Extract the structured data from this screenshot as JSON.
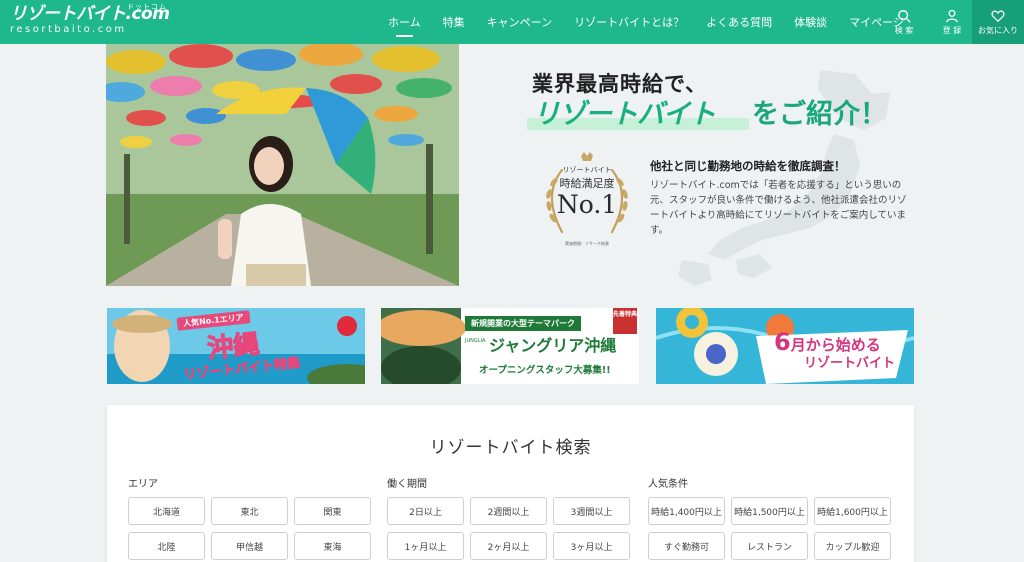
{
  "colors": {
    "brand_green": "#1fb88c",
    "fav_bg": "#169f78",
    "pink": "#d4357d"
  },
  "header": {
    "logo_text": "リゾートバイト.com",
    "logo_kana": "ドットコム",
    "logo_sub": "resortbaito.com",
    "nav": [
      "ホーム",
      "特集",
      "キャンペーン",
      "リゾートバイトとは？",
      "よくある質問",
      "体験談",
      "マイページ"
    ],
    "icons": {
      "search": "検 索",
      "login": "登 録",
      "favorite": "お気に入り"
    }
  },
  "hero": {
    "headline_1": "業界最高時給で、",
    "headline_2_highlight": "リゾートバイト",
    "headline_2_rest": "をご紹介！",
    "badge": {
      "line1": "リゾートバイト",
      "line2": "時給満足度",
      "rank": "No.1",
      "note": "実施期間：リサーチ結果"
    },
    "sub_heading": "他社と同じ勤務地の時給を徹底調査！",
    "sub_body": "リゾートバイト.comでは「若者を応援する」という思いの元、スタッフが良い条件で働けるよう、他社派遣会社のリゾートバイトより高時給にてリゾートバイトをご案内しています。"
  },
  "banners": {
    "okinawa": {
      "tag": "人気No.1エリア",
      "main": "沖縄",
      "sub": "リゾートバイト特集"
    },
    "junglia": {
      "top": "新規開業の大型テーマパーク",
      "logo": "JUNGLIA",
      "main": "ジャングリア沖縄",
      "bottom": "オープニングスタッフ大募集!!",
      "ribbon": "先着特典"
    },
    "june": {
      "month_num": "6",
      "month_rest": "月から始める",
      "sub": "リゾートバイト"
    }
  },
  "search": {
    "title": "リゾートバイト検索",
    "area": {
      "label": "エリア",
      "options": [
        "北海道",
        "東北",
        "関東",
        "北陸",
        "甲信越",
        "東海"
      ]
    },
    "period": {
      "label": "働く期間",
      "options": [
        "2日以上",
        "2週間以上",
        "3週間以上",
        "1ヶ月以上",
        "2ヶ月以上",
        "3ヶ月以上"
      ]
    },
    "conditions": {
      "label": "人気条件",
      "options": [
        "時給1,400円以上",
        "時給1,500円以上",
        "時給1,600円以上",
        "すぐ勤務可",
        "レストラン",
        "カップル歓迎"
      ]
    }
  }
}
